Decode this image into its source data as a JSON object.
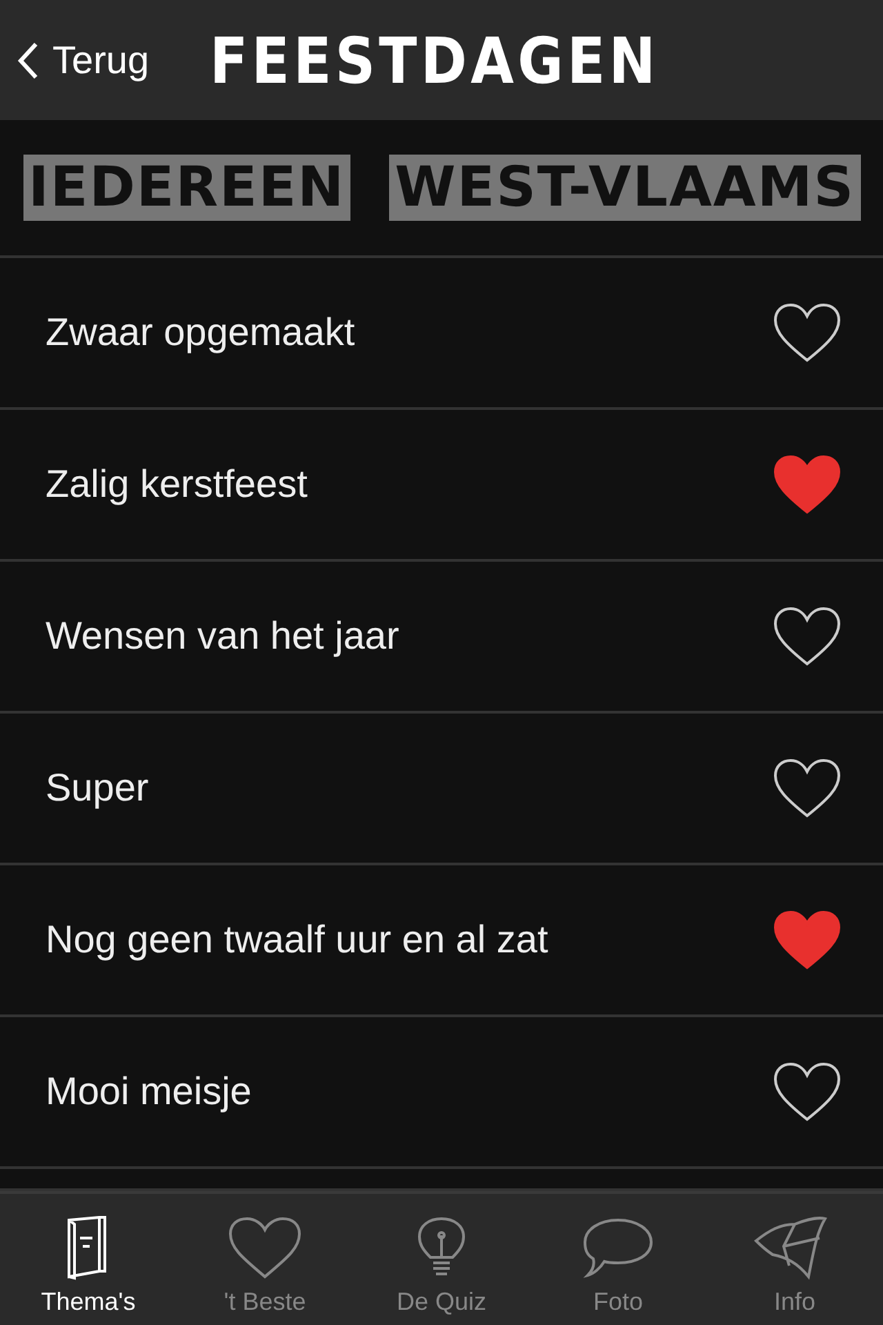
{
  "header": {
    "back": "Terug",
    "title": "FEESTDAGEN"
  },
  "filters": [
    {
      "label": "IEDEREEN"
    },
    {
      "label": "WEST-VLAAMS"
    }
  ],
  "items": [
    {
      "label": "Zwaar opgemaakt",
      "favorite": false
    },
    {
      "label": "Zalig kerstfeest",
      "favorite": true
    },
    {
      "label": "Wensen van het jaar",
      "favorite": false
    },
    {
      "label": "Super",
      "favorite": false
    },
    {
      "label": "Nog geen twaalf uur en al zat",
      "favorite": true
    },
    {
      "label": "Mooi meisje",
      "favorite": false
    }
  ],
  "tabbar": [
    {
      "label": "Thema's",
      "kind": "book",
      "selected": true
    },
    {
      "label": "'t Beste",
      "kind": "heart",
      "selected": false
    },
    {
      "label": "De Quiz",
      "kind": "bulb",
      "selected": false
    },
    {
      "label": "Foto",
      "kind": "bubble",
      "selected": false
    },
    {
      "label": "Info",
      "kind": "kite",
      "selected": false
    }
  ]
}
